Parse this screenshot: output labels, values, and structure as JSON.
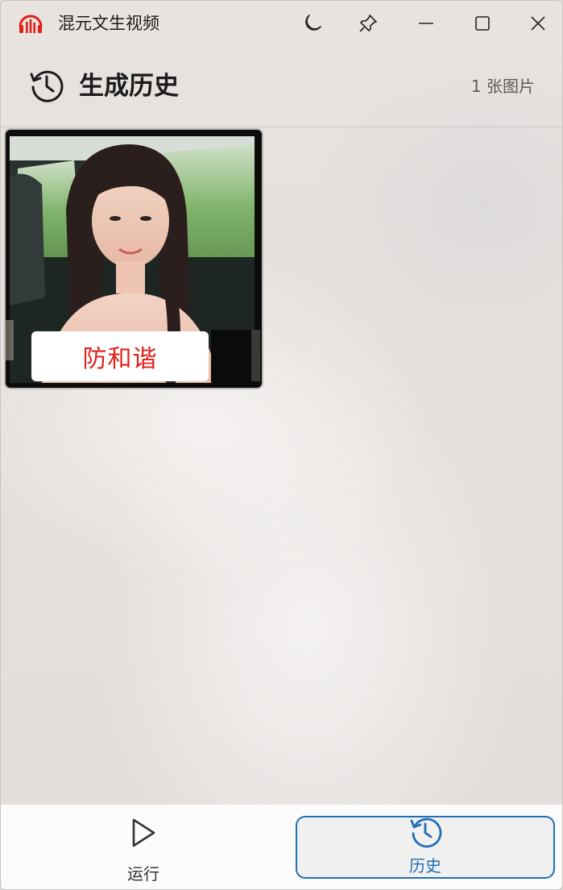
{
  "app": {
    "title": "混元文生视频"
  },
  "titlebar": {
    "buttons": [
      "moon-icon",
      "pin-icon",
      "minimize-icon",
      "maximize-icon",
      "close-icon"
    ]
  },
  "header": {
    "title": "生成历史",
    "count": "1 张图片"
  },
  "gallery": {
    "items": [
      {
        "overlay_text": "防和谐"
      }
    ]
  },
  "nav": {
    "run_label": "运行",
    "history_label": "历史"
  },
  "colors": {
    "accent": "#1f6fb6",
    "icon_red": "#e0201a",
    "overlay_text": "#e0201a"
  }
}
